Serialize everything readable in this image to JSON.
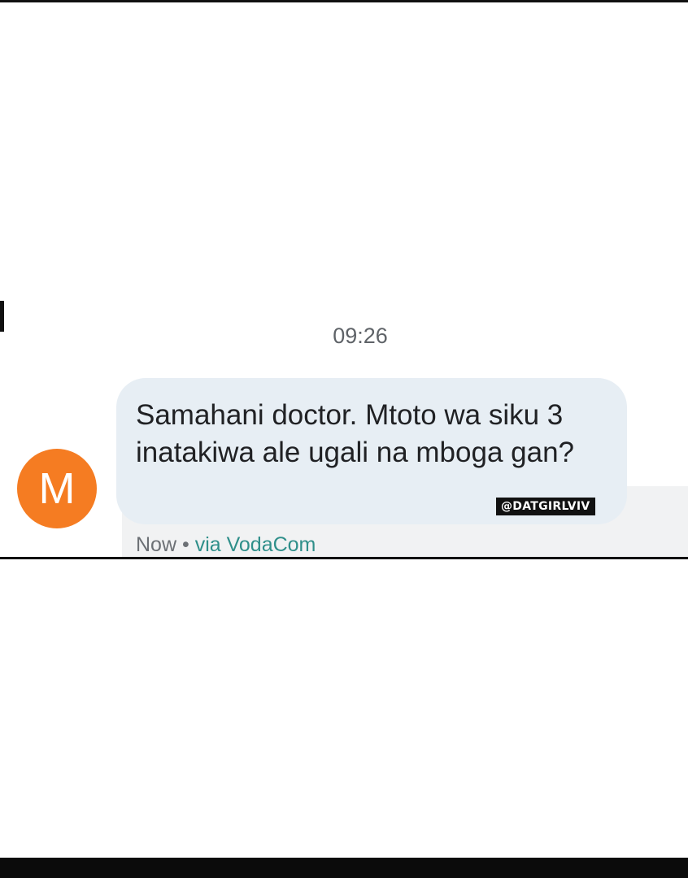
{
  "thread": {
    "time_header": "09:26"
  },
  "message": {
    "avatar_letter": "M",
    "text": "Samahani doctor. Mtoto wa siku 3 inatakiwa ale ugali na mboga gan?",
    "status": "Now",
    "separator": "•",
    "via_text": "via VodaCom"
  },
  "overlay": {
    "watermark": "@DATGIRLVIV"
  },
  "colors": {
    "avatar": "#f57c22",
    "bubble": "#e7eef4",
    "carrier_link": "#2f8f8a"
  }
}
